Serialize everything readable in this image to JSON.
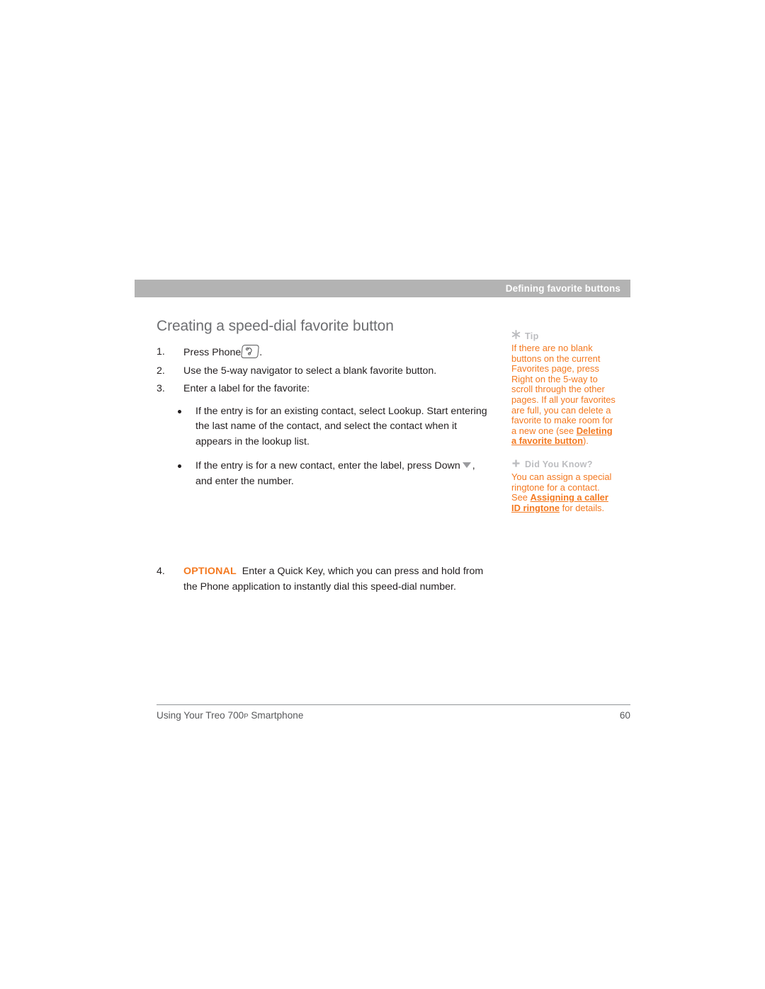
{
  "header": {
    "running_title": "Defining favorite buttons"
  },
  "main": {
    "heading": "Creating a speed-dial favorite button",
    "steps": [
      {
        "num": "1.",
        "text_before": "Press Phone",
        "icon": "phone-keycap-icon",
        "text_after": "."
      },
      {
        "num": "2.",
        "text_before": "Use the 5-way navigator to select a blank favorite button.",
        "icon": "",
        "text_after": ""
      },
      {
        "num": "3.",
        "text_before": "Enter a label for the favorite:",
        "icon": "",
        "text_after": ""
      }
    ],
    "bullets": [
      {
        "text_before": "If the entry is for an existing contact, select Lookup. Start entering the last name of the contact, and select the contact when it appears in the lookup list.",
        "icon": "",
        "text_after": ""
      },
      {
        "text_before": "If the entry is for a new contact, enter the label, press Down",
        "icon": "triangle-down-icon",
        "text_after": ", and enter the number."
      }
    ],
    "optional_step": {
      "num": "4.",
      "tag": "OPTIONAL",
      "text": "Enter a Quick Key, which you can press and hold from the Phone application to instantly dial this speed-dial number."
    }
  },
  "sidebar": {
    "tip": {
      "icon": "asterisk-icon",
      "label": "Tip",
      "text_part1": "If there are no blank buttons on the current Favorites page, press Right on the 5-way to scroll through the other pages. If all your favorites are full, you can delete a favorite to make room for a new one (see ",
      "link": "Deleting a favorite button",
      "text_part2": ")."
    },
    "did_you_know": {
      "icon": "plus-icon",
      "label": "Did You Know?",
      "text_part1": "You can assign a special ringtone for a contact. See ",
      "link": "Assigning a caller ID ringtone",
      "text_part2": " for details."
    }
  },
  "footer": {
    "document_title_before": "Using Your Treo 700",
    "document_title_superscript": "P",
    "document_title_after": " Smartphone",
    "page_number": "60"
  },
  "colors": {
    "accent_orange": "#f47920",
    "header_bar_gray": "#b3b3b3",
    "heading_gray": "#6d6e71",
    "sidebar_label_gray": "#bcbdc0"
  }
}
